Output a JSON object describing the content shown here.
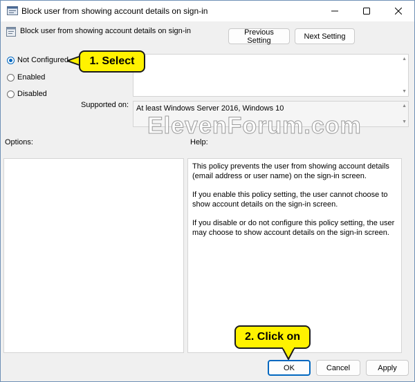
{
  "window": {
    "title": "Block user from showing account details on sign-in"
  },
  "policy": {
    "title": "Block user from showing account details on sign-in"
  },
  "nav": {
    "previous_label": "Previous Setting",
    "next_label": "Next Setting"
  },
  "state": {
    "not_configured_label": "Not Configured",
    "enabled_label": "Enabled",
    "disabled_label": "Disabled",
    "selected": "Not Configured"
  },
  "comment": {
    "value": ""
  },
  "supported": {
    "label": "Supported on:",
    "value": "At least Windows Server 2016, Windows 10"
  },
  "watermark": "ElevenForum.com",
  "options": {
    "label": "Options:"
  },
  "help": {
    "label": "Help:",
    "paragraphs": [
      "This policy prevents the user from showing account details (email address or user name) on the sign-in screen.",
      "If you enable this policy setting, the user cannot choose to show account details on the sign-in screen.",
      "If you disable or do not configure this policy setting, the user may choose to show account details on the sign-in screen."
    ]
  },
  "footer": {
    "ok_label": "OK",
    "cancel_label": "Cancel",
    "apply_label": "Apply"
  },
  "callouts": {
    "select": "1. Select",
    "click": "2. Click on"
  },
  "colors": {
    "accent": "#0067c0",
    "callout_fill": "#fff200",
    "window_bg": "#f0f0f0"
  },
  "icons": {
    "minimize": "minimize-icon",
    "maximize": "maximize-icon",
    "close": "close-icon"
  }
}
